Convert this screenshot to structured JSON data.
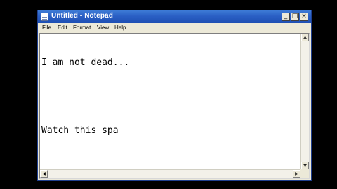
{
  "window": {
    "title": "Untitled - Notepad",
    "controls": {
      "minimize": "_",
      "maximize": "□",
      "close": "×"
    }
  },
  "menu": {
    "items": [
      "File",
      "Edit",
      "Format",
      "View",
      "Help"
    ]
  },
  "editor": {
    "lines": [
      "I am not dead...",
      "",
      "Watch this spa"
    ]
  },
  "scrollbars": {
    "up_arrow": "▲",
    "down_arrow": "▼",
    "left_arrow": "◀",
    "right_arrow": "▶"
  }
}
